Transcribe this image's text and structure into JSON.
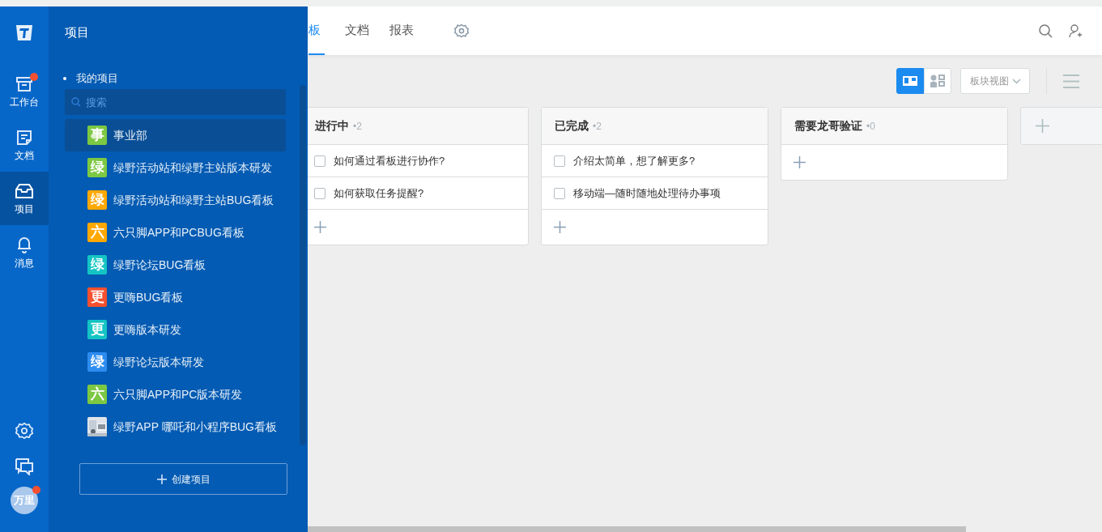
{
  "rail": {
    "items": [
      {
        "kind": "workbench",
        "label": "工作台",
        "badge": true,
        "selected": false
      },
      {
        "kind": "docs",
        "label": "文档",
        "badge": false,
        "selected": false
      },
      {
        "kind": "projects",
        "label": "项目",
        "badge": false,
        "selected": true
      },
      {
        "kind": "messages",
        "label": "消息",
        "badge": false,
        "selected": false
      }
    ],
    "avatar": {
      "text": "万里",
      "badge": true
    }
  },
  "drawer": {
    "title": "项目",
    "section": "我的项目",
    "search": {
      "placeholder": "搜索"
    },
    "projects": [
      {
        "kind": "letter",
        "icon_text": "事",
        "color": "#7cc843",
        "name": "事业部",
        "selected": true
      },
      {
        "kind": "letter",
        "icon_text": "绿",
        "color": "#7cc843",
        "name": "绿野活动站和绿野主站版本研发",
        "selected": false
      },
      {
        "kind": "letter",
        "icon_text": "绿",
        "color": "#ffa800",
        "name": "绿野活动站和绿野主站BUG看板",
        "selected": false
      },
      {
        "kind": "letter",
        "icon_text": "六",
        "color": "#ffa800",
        "name": "六只脚APP和PCBUG看板",
        "selected": false
      },
      {
        "kind": "letter",
        "icon_text": "绿",
        "color": "#14c4c4",
        "name": "绿野论坛BUG看板",
        "selected": false
      },
      {
        "kind": "letter",
        "icon_text": "更",
        "color": "#f5502f",
        "name": "更嗨BUG看板",
        "selected": false
      },
      {
        "kind": "letter",
        "icon_text": "更",
        "color": "#14c4c4",
        "name": "更嗨版本研发",
        "selected": false
      },
      {
        "kind": "letter",
        "icon_text": "绿",
        "color": "#2d8cf0",
        "name": "绿野论坛版本研发",
        "selected": false
      },
      {
        "kind": "letter",
        "icon_text": "六",
        "color": "#7cc843",
        "name": "六只脚APP和PC版本研发",
        "selected": false
      },
      {
        "kind": "picture",
        "name": "绿野APP 哪吒和小程序BUG看板",
        "selected": false
      }
    ],
    "create_button": "创建项目"
  },
  "tabs": [
    {
      "label": "板",
      "selected": true
    },
    {
      "label": "文档",
      "selected": false
    },
    {
      "label": "报表",
      "selected": false
    }
  ],
  "toolbar": {
    "view_toggle": [
      {
        "kind": "board",
        "selected": true
      },
      {
        "kind": "member",
        "selected": false
      }
    ],
    "view_dropdown": "板块视图"
  },
  "columns": [
    {
      "title": "进行中",
      "count": "•2",
      "tasks": [
        {
          "text": "如何通过看板进行协作?",
          "checked": false
        },
        {
          "text": "如何获取任务提醒?",
          "checked": false
        }
      ]
    },
    {
      "title": "已完成",
      "count": "•2",
      "tasks": [
        {
          "text": "介绍太简单，想了解更多?",
          "checked": false
        },
        {
          "text": "移动端—随时随地处理待办事项",
          "checked": false
        }
      ]
    },
    {
      "title": "需要龙哥验证",
      "count": "•0"
    }
  ]
}
